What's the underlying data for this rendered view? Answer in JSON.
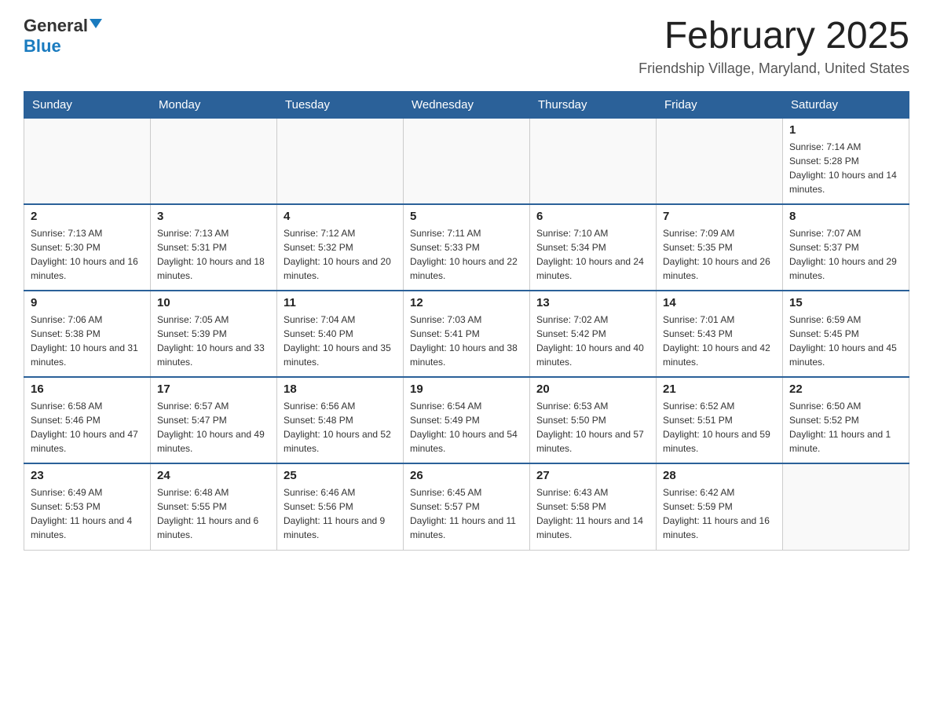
{
  "header": {
    "logo_general": "General",
    "logo_blue": "Blue",
    "month_title": "February 2025",
    "location": "Friendship Village, Maryland, United States"
  },
  "weekdays": [
    "Sunday",
    "Monday",
    "Tuesday",
    "Wednesday",
    "Thursday",
    "Friday",
    "Saturday"
  ],
  "weeks": [
    {
      "days": [
        {
          "number": "",
          "info": ""
        },
        {
          "number": "",
          "info": ""
        },
        {
          "number": "",
          "info": ""
        },
        {
          "number": "",
          "info": ""
        },
        {
          "number": "",
          "info": ""
        },
        {
          "number": "",
          "info": ""
        },
        {
          "number": "1",
          "info": "Sunrise: 7:14 AM\nSunset: 5:28 PM\nDaylight: 10 hours and 14 minutes."
        }
      ]
    },
    {
      "days": [
        {
          "number": "2",
          "info": "Sunrise: 7:13 AM\nSunset: 5:30 PM\nDaylight: 10 hours and 16 minutes."
        },
        {
          "number": "3",
          "info": "Sunrise: 7:13 AM\nSunset: 5:31 PM\nDaylight: 10 hours and 18 minutes."
        },
        {
          "number": "4",
          "info": "Sunrise: 7:12 AM\nSunset: 5:32 PM\nDaylight: 10 hours and 20 minutes."
        },
        {
          "number": "5",
          "info": "Sunrise: 7:11 AM\nSunset: 5:33 PM\nDaylight: 10 hours and 22 minutes."
        },
        {
          "number": "6",
          "info": "Sunrise: 7:10 AM\nSunset: 5:34 PM\nDaylight: 10 hours and 24 minutes."
        },
        {
          "number": "7",
          "info": "Sunrise: 7:09 AM\nSunset: 5:35 PM\nDaylight: 10 hours and 26 minutes."
        },
        {
          "number": "8",
          "info": "Sunrise: 7:07 AM\nSunset: 5:37 PM\nDaylight: 10 hours and 29 minutes."
        }
      ]
    },
    {
      "days": [
        {
          "number": "9",
          "info": "Sunrise: 7:06 AM\nSunset: 5:38 PM\nDaylight: 10 hours and 31 minutes."
        },
        {
          "number": "10",
          "info": "Sunrise: 7:05 AM\nSunset: 5:39 PM\nDaylight: 10 hours and 33 minutes."
        },
        {
          "number": "11",
          "info": "Sunrise: 7:04 AM\nSunset: 5:40 PM\nDaylight: 10 hours and 35 minutes."
        },
        {
          "number": "12",
          "info": "Sunrise: 7:03 AM\nSunset: 5:41 PM\nDaylight: 10 hours and 38 minutes."
        },
        {
          "number": "13",
          "info": "Sunrise: 7:02 AM\nSunset: 5:42 PM\nDaylight: 10 hours and 40 minutes."
        },
        {
          "number": "14",
          "info": "Sunrise: 7:01 AM\nSunset: 5:43 PM\nDaylight: 10 hours and 42 minutes."
        },
        {
          "number": "15",
          "info": "Sunrise: 6:59 AM\nSunset: 5:45 PM\nDaylight: 10 hours and 45 minutes."
        }
      ]
    },
    {
      "days": [
        {
          "number": "16",
          "info": "Sunrise: 6:58 AM\nSunset: 5:46 PM\nDaylight: 10 hours and 47 minutes."
        },
        {
          "number": "17",
          "info": "Sunrise: 6:57 AM\nSunset: 5:47 PM\nDaylight: 10 hours and 49 minutes."
        },
        {
          "number": "18",
          "info": "Sunrise: 6:56 AM\nSunset: 5:48 PM\nDaylight: 10 hours and 52 minutes."
        },
        {
          "number": "19",
          "info": "Sunrise: 6:54 AM\nSunset: 5:49 PM\nDaylight: 10 hours and 54 minutes."
        },
        {
          "number": "20",
          "info": "Sunrise: 6:53 AM\nSunset: 5:50 PM\nDaylight: 10 hours and 57 minutes."
        },
        {
          "number": "21",
          "info": "Sunrise: 6:52 AM\nSunset: 5:51 PM\nDaylight: 10 hours and 59 minutes."
        },
        {
          "number": "22",
          "info": "Sunrise: 6:50 AM\nSunset: 5:52 PM\nDaylight: 11 hours and 1 minute."
        }
      ]
    },
    {
      "days": [
        {
          "number": "23",
          "info": "Sunrise: 6:49 AM\nSunset: 5:53 PM\nDaylight: 11 hours and 4 minutes."
        },
        {
          "number": "24",
          "info": "Sunrise: 6:48 AM\nSunset: 5:55 PM\nDaylight: 11 hours and 6 minutes."
        },
        {
          "number": "25",
          "info": "Sunrise: 6:46 AM\nSunset: 5:56 PM\nDaylight: 11 hours and 9 minutes."
        },
        {
          "number": "26",
          "info": "Sunrise: 6:45 AM\nSunset: 5:57 PM\nDaylight: 11 hours and 11 minutes."
        },
        {
          "number": "27",
          "info": "Sunrise: 6:43 AM\nSunset: 5:58 PM\nDaylight: 11 hours and 14 minutes."
        },
        {
          "number": "28",
          "info": "Sunrise: 6:42 AM\nSunset: 5:59 PM\nDaylight: 11 hours and 16 minutes."
        },
        {
          "number": "",
          "info": ""
        }
      ]
    }
  ]
}
